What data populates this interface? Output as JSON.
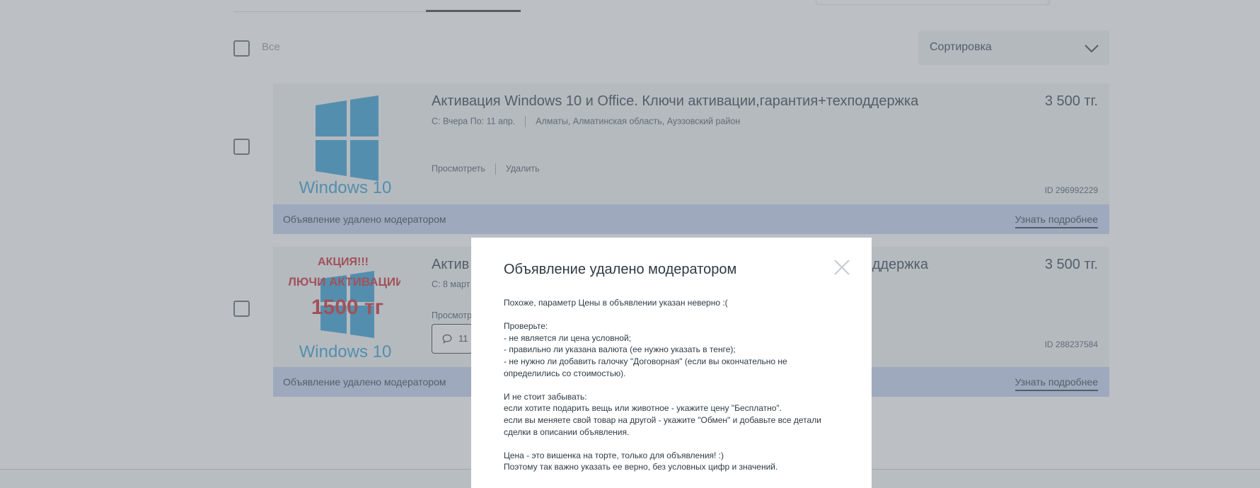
{
  "list": {
    "select_all_label": "Все",
    "sort_label": "Сортировка"
  },
  "listings": [
    {
      "title": "Активация Windows 10 и Office. Ключи активации,гарантия+техподдержка",
      "dates": "С: Вчера По: 11 апр.",
      "location": "Алматы, Алматинская область, Ауэзовский район",
      "price": "3 500 тг.",
      "id": "ID 296992229",
      "view_label": "Просмотреть",
      "delete_label": "Удалить",
      "image_caption": "Windows 10",
      "banner_text": "Объявление удалено модератором",
      "banner_link": "Узнать подробнее"
    },
    {
      "title": "Актив",
      "title_end": "ддержка",
      "dates": "С: 8 март",
      "price": "3 500 тг.",
      "id": "ID 288237584",
      "view_label": "Просмотр",
      "messages_count": "11",
      "image_overlay": {
        "line1": "АКЦИЯ!!!",
        "line2": "КЛЮЧИ АКТИВАЦИИ",
        "line3": "1500 тг"
      },
      "image_caption": "Windows 10",
      "banner_text": "Объявление удалено модератором",
      "banner_link": "Узнать подробнее"
    }
  ],
  "modal": {
    "title": "Объявление удалено модератором",
    "intro": "Похоже, параметр Цены в объявлении указан неверно :(",
    "check_heading": "Проверьте:",
    "check_1": "- не является ли цена условной;",
    "check_2": "- правильно ли указана валюта (ее нужно указать в тенге);",
    "check_3a": "- не нужно ли добавить галочку \"Договорная\" (если вы окончательно не",
    "check_3b": "определились со стоимостью).",
    "remember_heading": "И не стоит забывать:",
    "remember_1": "если хотите подарить вещь или животное - укажите цену \"Бесплатно\".",
    "remember_2a": "если вы меняете свой товар на другой - укажите \"Обмен\" и добавьте все детали",
    "remember_2b": "сделки в описании объявления.",
    "closing_1": "Цена - это вишенка на торте, только для объявления! :)",
    "closing_2": "Поэтому так важно указать ее верно, без условных цифр и значений."
  },
  "colors": {
    "windows_blue": "#2f9bd2",
    "promo_red": "#c8232b",
    "banner_bg": "#c3d0f0",
    "text_dark": "#2e3a44"
  },
  "icons": {
    "sort": "chevron-down-icon",
    "close": "close-icon",
    "messages": "chat-bubble-icon"
  }
}
